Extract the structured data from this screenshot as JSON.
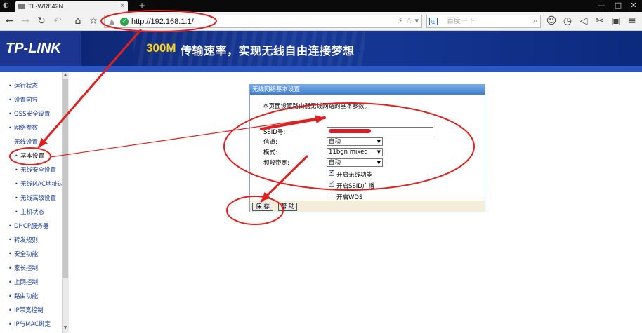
{
  "browser": {
    "tab_title": "TL-WR842N",
    "new_tab": "+",
    "url": "http://192.168.1.1/",
    "search_placeholder": "百度一下",
    "window_buttons": [
      "—",
      "□",
      "✕"
    ]
  },
  "header": {
    "logo": "TP-LINK",
    "slogan_number": "300M",
    "slogan_text": "传输速率，实现无线自由连接梦想"
  },
  "sidebar": {
    "items": [
      {
        "label": "运行状态",
        "level": "top"
      },
      {
        "label": "设置向导",
        "level": "top"
      },
      {
        "label": "QSS安全设置",
        "level": "top"
      },
      {
        "label": "网络参数",
        "level": "top"
      },
      {
        "label": "无线设置",
        "level": "top",
        "marker": "-"
      },
      {
        "label": "基本设置",
        "level": "sub",
        "active": true
      },
      {
        "label": "无线安全设置",
        "level": "sub"
      },
      {
        "label": "无线MAC地址过滤",
        "level": "sub"
      },
      {
        "label": "无线高级设置",
        "level": "sub"
      },
      {
        "label": "主机状态",
        "level": "sub"
      },
      {
        "label": "DHCP服务器",
        "level": "top"
      },
      {
        "label": "转发规则",
        "level": "top"
      },
      {
        "label": "安全功能",
        "level": "top"
      },
      {
        "label": "家长控制",
        "level": "top"
      },
      {
        "label": "上网控制",
        "level": "top"
      },
      {
        "label": "路由功能",
        "level": "top"
      },
      {
        "label": "IP带宽控制",
        "level": "top"
      },
      {
        "label": "IP与MAC绑定",
        "level": "top"
      }
    ]
  },
  "panel": {
    "title": "无线网络基本设置",
    "intro": "本页面设置路由器无线网络的基本参数。",
    "ssid_label": "SSID号:",
    "channel_label": "信道:",
    "channel_value": "自动",
    "mode_label": "模式:",
    "mode_value": "11bgn mixed",
    "bandwidth_label": "频段带宽:",
    "bandwidth_value": "自动",
    "enable_wireless_label": "开启无线功能",
    "enable_wireless": true,
    "ssid_broadcast_label": "开启SSID广播",
    "ssid_broadcast": true,
    "wds_label": "开启WDS",
    "wds": false,
    "save_label": "保 存",
    "help_label": "帮 助"
  },
  "annotations": {
    "color": "#e02020"
  },
  "colors": {
    "header_blue": "#0d2a7a",
    "nav_text": "#1c3e95",
    "panel_head": "#4b8ad8",
    "panel_foot": "#f5edd7",
    "slogan_accent": "#ffd21a"
  }
}
